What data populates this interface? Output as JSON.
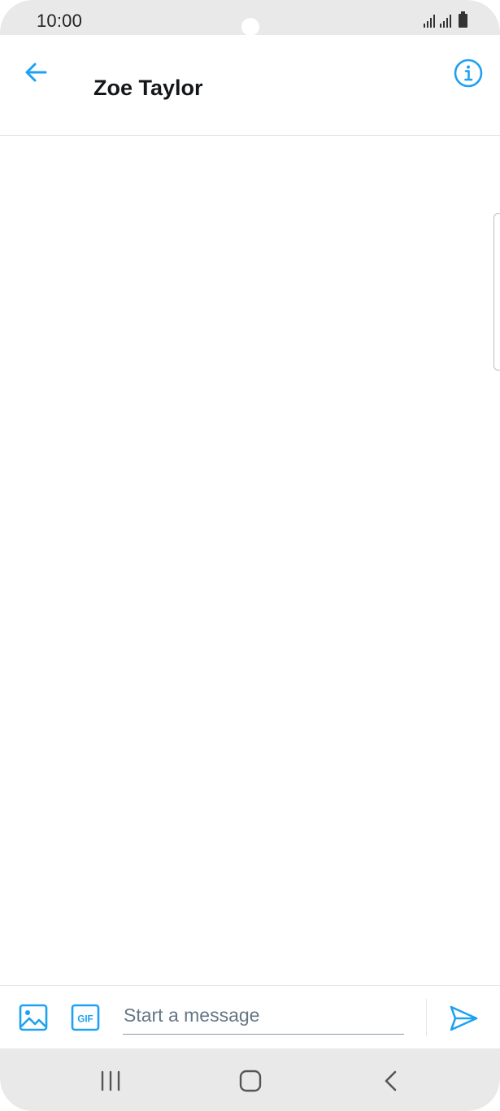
{
  "status_bar": {
    "time": "10:00",
    "icons": [
      "signal-icon",
      "signal-icon",
      "battery-icon"
    ]
  },
  "header": {
    "title": "Zoe Taylor",
    "back_icon": "arrow-left-icon",
    "info_icon": "info-icon"
  },
  "composer": {
    "placeholder": "Start a message",
    "media_icon": "image-icon",
    "gif_icon": "gif-icon",
    "gif_label": "GIF",
    "send_icon": "send-icon"
  },
  "nav_bar": {
    "icons": [
      "recent-apps-icon",
      "home-icon",
      "back-icon"
    ]
  },
  "colors": {
    "accent": "#1da1f2",
    "title_text": "#14171a",
    "placeholder_text": "#657786",
    "system_bar_bg": "#e9e9e9"
  }
}
